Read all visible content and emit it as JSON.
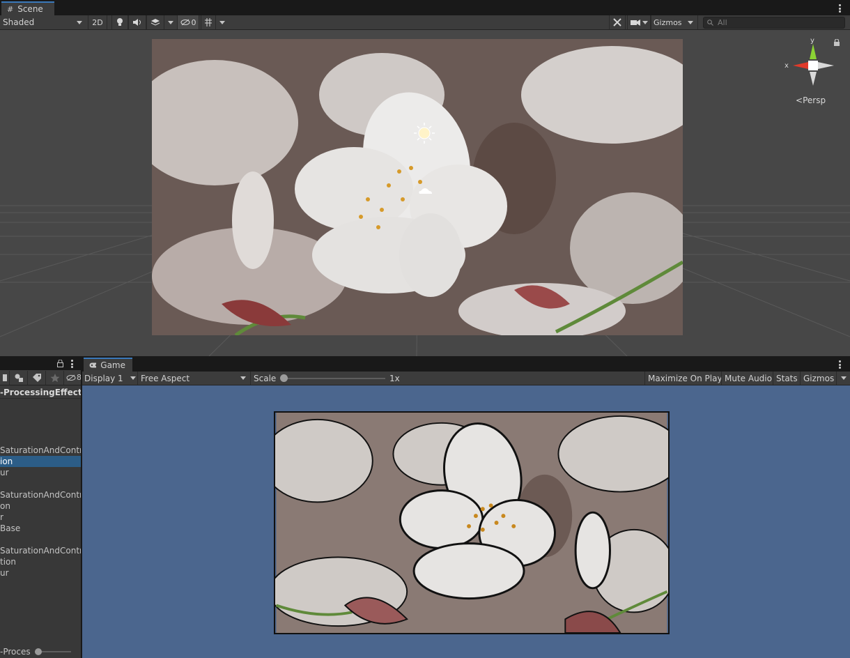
{
  "scene": {
    "tab_label": "Scene",
    "shading_mode": "Shaded",
    "mode_2d": "2D",
    "hidden_count": "0",
    "gizmos_label": "Gizmos",
    "search_placeholder": "All",
    "orientation_label": "Persp",
    "axis_x": "x",
    "axis_y": "y"
  },
  "hierarchy": {
    "hidden_count": "8",
    "root_label": "-ProcessingEffects",
    "rows": [
      {
        "label": "SaturationAndContras",
        "selected": false
      },
      {
        "label": "ion",
        "selected": true
      },
      {
        "label": "ur",
        "selected": false
      },
      {
        "label": "",
        "selected": false
      },
      {
        "label": "SaturationAndContrast",
        "selected": false
      },
      {
        "label": "on",
        "selected": false
      },
      {
        "label": "r",
        "selected": false
      },
      {
        "label": "Base",
        "selected": false
      },
      {
        "label": "",
        "selected": false
      },
      {
        "label": "SaturationAndContras",
        "selected": false
      },
      {
        "label": "tion",
        "selected": false
      },
      {
        "label": "ur",
        "selected": false
      }
    ],
    "footer_label": "-Proces"
  },
  "game": {
    "tab_label": "Game",
    "display": "Display 1",
    "aspect": "Free Aspect",
    "scale_label": "Scale",
    "scale_value": "1x",
    "maximize_label": "Maximize On Play",
    "mute_label": "Mute Audio",
    "stats_label": "Stats",
    "gizmos_label": "Gizmos"
  },
  "colors": {
    "selection": "#2c5d87",
    "game_background": "#4b668e",
    "scene_background": "#474747",
    "axis_x": "#e03a2a",
    "axis_y": "#8bd334"
  }
}
